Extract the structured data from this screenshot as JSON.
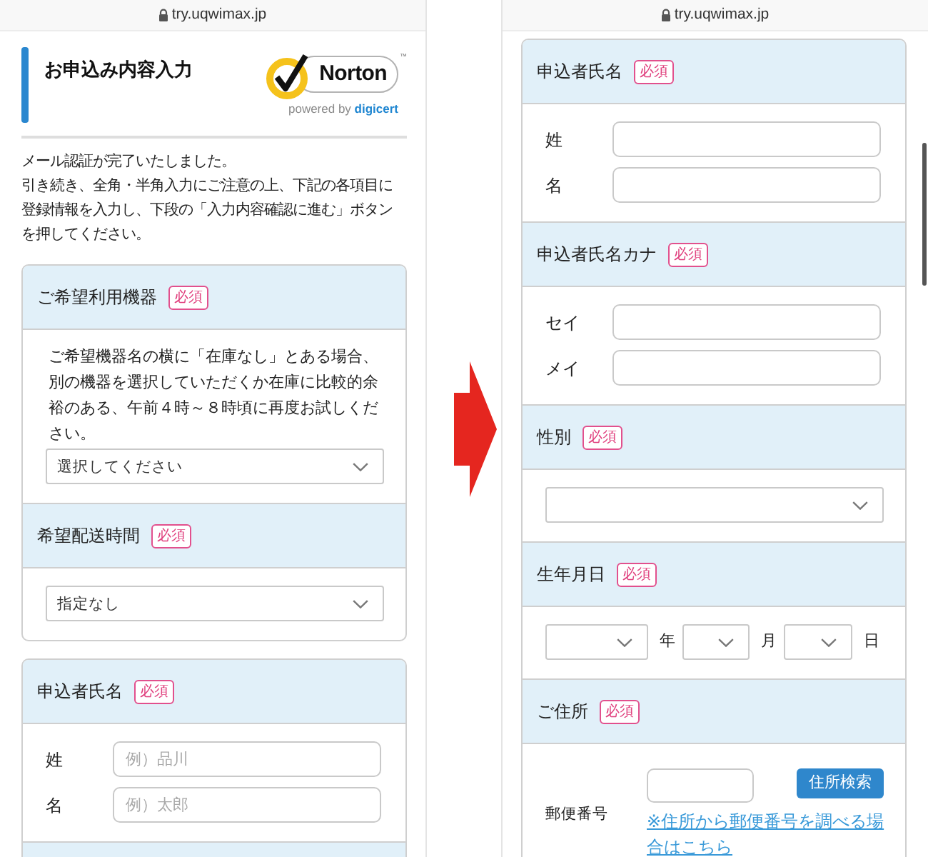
{
  "screens": [
    {
      "address_bar": {
        "url": "try.uqwimax.jp"
      },
      "page_header": {
        "title": "お申込み内容入力",
        "seal": {
          "wordmark": "Norton",
          "trademark": "™",
          "tagline": "powered by **digicert**"
        }
      },
      "intro": [
        "メール認証が完了いたしました。",
        "引き続き、全角・半角入力にご注意の上、下記の各項目に登録情報を入力し、下段の「入力内容確認に進む」ボタンを押してください。"
      ],
      "cards": [
        {
          "sections": [
            {
              "title": "ご希望利用機器",
              "badge": "必須",
              "body": [
                {
                  "kind": "note",
                  "text": "ご希望機器名の横に「在庫なし」とある場合、別の機器を選択していただくか在庫に比較的余裕のある、午前４時～８時頃に再度お試しください。"
                },
                {
                  "kind": "select",
                  "value": "選択してください"
                }
              ]
            },
            {
              "title": "希望配送時間",
              "badge": "必須",
              "body": [
                {
                  "kind": "select",
                  "value": "指定なし"
                }
              ]
            }
          ]
        },
        {
          "sections": [
            {
              "title": "申込者氏名",
              "badge": "必須",
              "body": [
                {
                  "kind": "text_input",
                  "label": "姓",
                  "placeholder": "例）品川"
                },
                {
                  "kind": "text_input",
                  "label": "名",
                  "placeholder": "例）太郎"
                }
              ]
            }
          ],
          "next_section_peek": true
        }
      ]
    },
    {
      "address_bar": {
        "url": "try.uqwimax.jp"
      },
      "scroll_indicator": true,
      "cards": [
        {
          "sections": [
            {
              "title": "申込者氏名",
              "badge": "必須",
              "body": [
                {
                  "kind": "text_input",
                  "label": "姓"
                },
                {
                  "kind": "text_input",
                  "label": "名"
                }
              ]
            },
            {
              "title": "申込者氏名カナ",
              "badge": "必須",
              "body": [
                {
                  "kind": "text_input",
                  "label": "セイ"
                },
                {
                  "kind": "text_input",
                  "label": "メイ"
                }
              ]
            },
            {
              "title": "性別",
              "badge": "必須",
              "body": [
                {
                  "kind": "select"
                }
              ]
            },
            {
              "title": "生年月日",
              "badge": "必須",
              "body": [
                {
                  "kind": "date_select",
                  "units": [
                    "年",
                    "月",
                    "日"
                  ]
                }
              ]
            },
            {
              "title": "ご住所",
              "badge": "必須",
              "body": [
                {
                  "kind": "postal",
                  "label": "郵便番号",
                  "button": "住所検索",
                  "link": "※住所から郵便番号を調べる場合はこちら"
                }
              ]
            }
          ]
        }
      ]
    }
  ]
}
